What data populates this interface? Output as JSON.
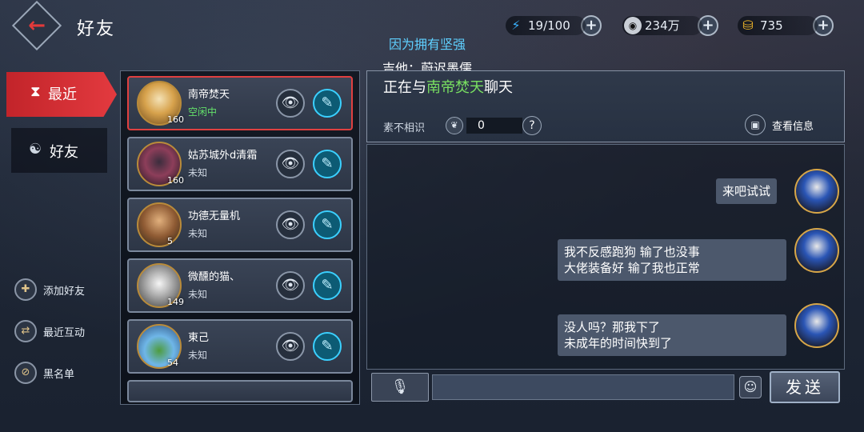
{
  "header": {
    "back_icon": "back-arrow-icon",
    "title": "好友",
    "resources": [
      {
        "icon": "energy-icon",
        "value": "19/100"
      },
      {
        "icon": "silver-coin-icon",
        "value": "234万"
      },
      {
        "icon": "gold-ingot-icon",
        "value": "735"
      }
    ]
  },
  "floating_text": {
    "line1": "因为拥有坚强",
    "line2": "吉他：蔚迟墨儒"
  },
  "nav": {
    "recent": "最近",
    "friends": "好友"
  },
  "side_actions": [
    {
      "icon": "add-friend-icon",
      "label": "添加好友"
    },
    {
      "icon": "interaction-icon",
      "label": "最近互动"
    },
    {
      "icon": "blacklist-icon",
      "label": "黑名单"
    }
  ],
  "friends": [
    {
      "name": "南帝焚天",
      "status": "空闲中",
      "level": "160",
      "online": true
    },
    {
      "name": "姑苏城外d清霜",
      "status": "未知",
      "level": "160",
      "online": false
    },
    {
      "name": "功德无量机",
      "status": "未知",
      "level": "5",
      "online": false
    },
    {
      "name": "微醺的猫、",
      "status": "未知",
      "level": "149",
      "online": false
    },
    {
      "name": "東己",
      "status": "未知",
      "level": "54",
      "online": false
    }
  ],
  "chat": {
    "title_prefix": "正在与",
    "title_name": "南帝焚天",
    "title_suffix": "聊天",
    "relation_label": "素不相识",
    "relation_value": "0",
    "help": "?",
    "view_info": "查看信息",
    "messages": [
      {
        "lines": [
          "来吧试试"
        ]
      },
      {
        "lines": [
          "我不反感跑狗 输了也没事",
          "大佬装备好 输了我也正常"
        ]
      },
      {
        "lines": [
          "没人吗？那我下了",
          "未成年的时间快到了"
        ]
      }
    ],
    "input_placeholder": "",
    "send_label": "发送"
  }
}
